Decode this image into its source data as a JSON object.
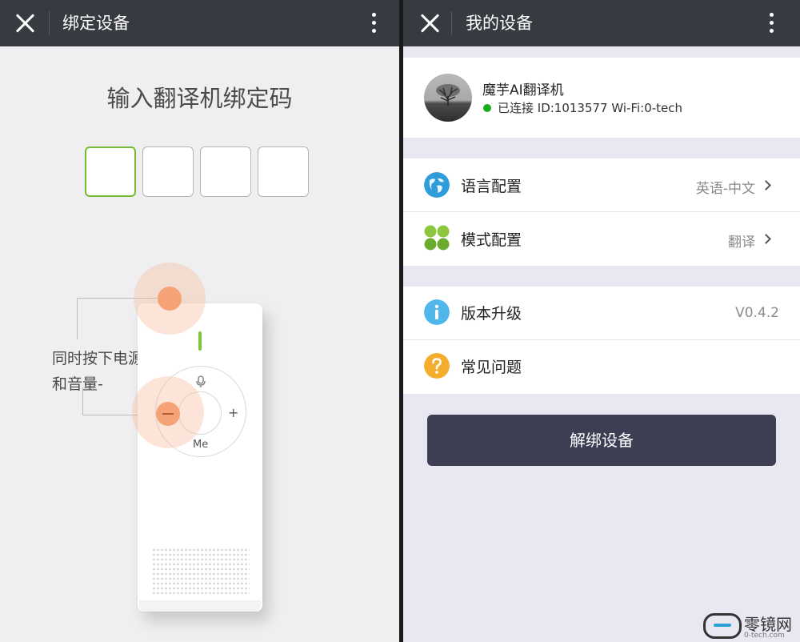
{
  "left": {
    "title": "绑定设备",
    "heading": "输入翻译机绑定码",
    "code_boxes": [
      "",
      "",
      "",
      ""
    ],
    "instruction_line1": "同时按下电源",
    "instruction_line2": "和音量-",
    "device": {
      "plus": "+",
      "me_label": "Me"
    }
  },
  "right": {
    "title": "我的设备",
    "device_card": {
      "name": "魔芋AI翻译机",
      "status": "已连接 ID:1013577 Wi-Fi:0-tech",
      "status_color": "#1aac19"
    },
    "settings": [
      {
        "label": "语言配置",
        "value": "英语-中文",
        "icon": "globe-icon"
      },
      {
        "label": "模式配置",
        "value": "翻译",
        "icon": "grid-icon"
      }
    ],
    "info": [
      {
        "label": "版本升级",
        "value": "V0.4.2",
        "icon": "info-icon"
      },
      {
        "label": "常见问题",
        "icon": "question-icon"
      }
    ],
    "unbind_button": "解绑设备"
  },
  "watermark": {
    "brand": "零镜网",
    "url": "0-tech.com"
  },
  "colors": {
    "topbar": "#373a40",
    "accent_green": "#76ba33",
    "button": "#3d3e54",
    "highlight": "#f4a276"
  }
}
